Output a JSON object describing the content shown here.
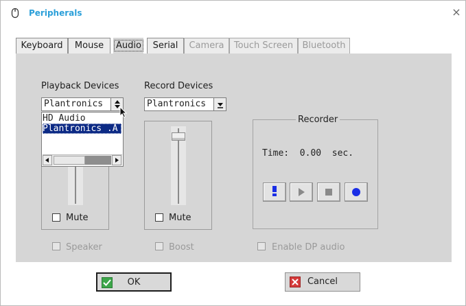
{
  "window": {
    "title": "Peripherals",
    "close_symbol": "×"
  },
  "tabs": [
    {
      "label": "Keyboard",
      "state": "enabled"
    },
    {
      "label": "Mouse",
      "state": "enabled"
    },
    {
      "label": "Audio",
      "state": "active"
    },
    {
      "label": "Serial",
      "state": "enabled"
    },
    {
      "label": "Camera",
      "state": "disabled"
    },
    {
      "label": "Touch Screen",
      "state": "disabled"
    },
    {
      "label": "Bluetooth",
      "state": "disabled"
    }
  ],
  "playback": {
    "label": "Playback Devices",
    "selected": "Plantronics",
    "options": [
      "HD Audio",
      "Plantronics .A"
    ],
    "mute_label": "Mute",
    "speaker_label": "Speaker"
  },
  "record": {
    "label": "Record Devices",
    "selected": "Plantronics",
    "mute_label": "Mute",
    "boost_label": "Boost"
  },
  "recorder": {
    "title": "Recorder",
    "time_text": "Time:  0.00  sec."
  },
  "dp_audio": {
    "label": "Enable DP audio"
  },
  "buttons": {
    "ok": "OK",
    "cancel": "Cancel"
  },
  "colors": {
    "title": "#2b9fd9",
    "panel": "#d6d6d6",
    "selection": "#0c2a85",
    "ok_icon": "#3da64a",
    "cancel_icon": "#d53b3b",
    "record_blue": "#1a2ee6"
  }
}
